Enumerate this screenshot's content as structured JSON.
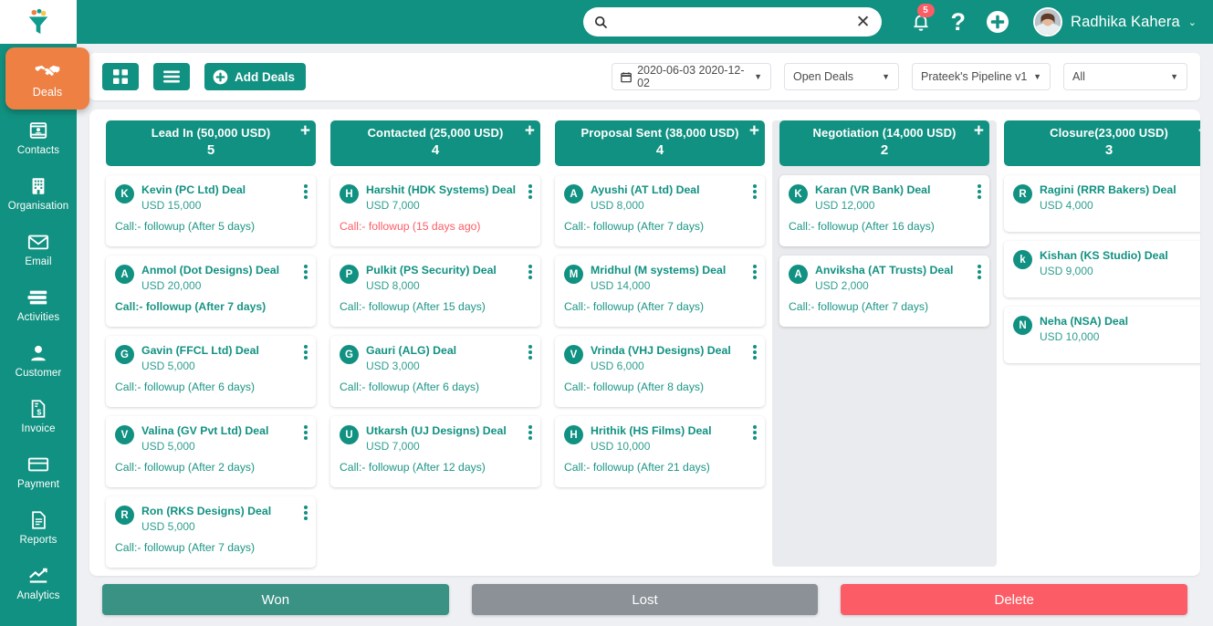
{
  "brand": {
    "primary": "#119181",
    "accent": "#ee8043",
    "danger": "#fc5c65",
    "muted": "#8b9196"
  },
  "sidebar": {
    "logo_icon": "funnel-logo-icon",
    "items": [
      {
        "label": "Deals",
        "icon": "handshake-icon",
        "active": true
      },
      {
        "label": "Contacts",
        "icon": "contact-card-icon",
        "active": false
      },
      {
        "label": "Organisation",
        "icon": "building-icon",
        "active": false
      },
      {
        "label": "Email",
        "icon": "envelope-icon",
        "active": false
      },
      {
        "label": "Activities",
        "icon": "list-stack-icon",
        "active": false
      },
      {
        "label": "Customer",
        "icon": "person-icon",
        "active": false
      },
      {
        "label": "Invoice",
        "icon": "invoice-dollar-icon",
        "active": false
      },
      {
        "label": "Payment",
        "icon": "credit-card-icon",
        "active": false
      },
      {
        "label": "Reports",
        "icon": "document-lines-icon",
        "active": false
      },
      {
        "label": "Analytics",
        "icon": "trend-up-icon",
        "active": false
      }
    ]
  },
  "topbar": {
    "search": {
      "value": "",
      "placeholder": "",
      "icon": "search-icon",
      "clear_icon": "close-icon",
      "clear_glyph": "✕"
    },
    "notification": {
      "icon": "bell-icon",
      "badge": "5"
    },
    "help": {
      "icon": "question-mark-icon",
      "glyph": "?"
    },
    "add": {
      "icon": "plus-circle-icon"
    },
    "user": {
      "name": "Radhika Kahera",
      "avatar_icon": "user-avatar",
      "caret_icon": "chevron-down-icon",
      "caret_glyph": "⌄"
    }
  },
  "toolbar": {
    "grid_view": {
      "icon": "grid-view-icon",
      "label": ""
    },
    "list_view": {
      "icon": "list-view-icon",
      "label": ""
    },
    "add_deals": {
      "label": "Add Deals",
      "icon": "plus-circle-icon"
    },
    "filters": [
      {
        "name": "date-range",
        "value": "2020-06-03 2020-12-02",
        "icon": "calendar-icon",
        "caret": "▼"
      },
      {
        "name": "deal-status",
        "value": "Open Deals",
        "caret": "▼"
      },
      {
        "name": "pipeline",
        "value": "Prateek's Pipeline v1",
        "caret": "▼"
      },
      {
        "name": "owner",
        "value": "All",
        "caret": "▼"
      }
    ]
  },
  "board": {
    "columns": [
      {
        "title": "Lead In (50,000 USD)",
        "count": "5",
        "highlighted": false,
        "add_icon": "plus-icon",
        "cards": [
          {
            "initial": "K",
            "title": "Kevin (PC Ltd) Deal",
            "amount": "USD 15,000",
            "followup": "Call:- followup (After 5 days)",
            "overdue": false,
            "bold": false
          },
          {
            "initial": "A",
            "title": "Anmol (Dot Designs) Deal",
            "amount": "USD 20,000",
            "followup": "Call:- followup (After 7 days)",
            "overdue": false,
            "bold": true
          },
          {
            "initial": "G",
            "title": "Gavin (FFCL Ltd) Deal",
            "amount": "USD 5,000",
            "followup": "Call:- followup (After 6 days)",
            "overdue": false,
            "bold": false
          },
          {
            "initial": "V",
            "title": "Valina (GV Pvt Ltd) Deal",
            "amount": "USD 5,000",
            "followup": "Call:- followup (After 2 days)",
            "overdue": false,
            "bold": false
          },
          {
            "initial": "R",
            "title": "Ron (RKS Designs) Deal",
            "amount": "USD 5,000",
            "followup": "Call:- followup (After 7 days)",
            "overdue": false,
            "bold": false
          }
        ]
      },
      {
        "title": "Contacted (25,000 USD)",
        "count": "4",
        "highlighted": false,
        "add_icon": "plus-icon",
        "cards": [
          {
            "initial": "H",
            "title": "Harshit (HDK Systems) Deal",
            "amount": "USD 7,000",
            "followup": "Call:- followup (15 days ago)",
            "overdue": true,
            "bold": false
          },
          {
            "initial": "P",
            "title": "Pulkit (PS Security) Deal",
            "amount": "USD 8,000",
            "followup": "Call:- followup (After 15 days)",
            "overdue": false,
            "bold": false
          },
          {
            "initial": "G",
            "title": "Gauri (ALG) Deal",
            "amount": "USD 3,000",
            "followup": "Call:- followup (After 6 days)",
            "overdue": false,
            "bold": false
          },
          {
            "initial": "U",
            "title": "Utkarsh (UJ Designs) Deal",
            "amount": "USD 7,000",
            "followup": "Call:- followup (After 12 days)",
            "overdue": false,
            "bold": false
          }
        ]
      },
      {
        "title": "Proposal Sent (38,000 USD)",
        "count": "4",
        "highlighted": false,
        "add_icon": "plus-icon",
        "cards": [
          {
            "initial": "A",
            "title": "Ayushi (AT Ltd) Deal",
            "amount": "USD 8,000",
            "followup": "Call:- followup (After 7 days)",
            "overdue": false,
            "bold": false
          },
          {
            "initial": "M",
            "title": "Mridhul (M systems) Deal",
            "amount": "USD 14,000",
            "followup": "Call:- followup (After 7 days)",
            "overdue": false,
            "bold": false
          },
          {
            "initial": "V",
            "title": "Vrinda (VHJ Designs) Deal",
            "amount": "USD 6,000",
            "followup": "Call:- followup (After 8 days)",
            "overdue": false,
            "bold": false
          },
          {
            "initial": "H",
            "title": "Hrithik (HS Films) Deal",
            "amount": "USD 10,000",
            "followup": "Call:- followup (After 21 days)",
            "overdue": false,
            "bold": false
          }
        ]
      },
      {
        "title": "Negotiation (14,000 USD)",
        "count": "2",
        "highlighted": true,
        "add_icon": "plus-icon",
        "cards": [
          {
            "initial": "K",
            "title": "Karan (VR Bank) Deal",
            "amount": "USD 12,000",
            "followup": "Call:- followup (After 16 days)",
            "overdue": false,
            "bold": false
          },
          {
            "initial": "A",
            "title": "Anviksha (AT Trusts) Deal",
            "amount": "USD 2,000",
            "followup": "Call:- followup (After 7 days)",
            "overdue": false,
            "bold": false
          }
        ]
      },
      {
        "title": "Closure(23,000 USD)",
        "count": "3",
        "highlighted": false,
        "add_icon": "plus-icon",
        "cards": [
          {
            "initial": "R",
            "title": "Ragini (RRR Bakers) Deal",
            "amount": "USD 4,000",
            "followup": "",
            "overdue": false,
            "bold": false
          },
          {
            "initial": "k",
            "title": "Kishan (KS Studio) Deal",
            "amount": "USD 9,000",
            "followup": "",
            "overdue": false,
            "bold": false
          },
          {
            "initial": "N",
            "title": "Neha (NSA) Deal",
            "amount": "USD 10,000",
            "followup": "",
            "overdue": false,
            "bold": false
          }
        ]
      }
    ]
  },
  "footer": {
    "won": "Won",
    "lost": "Lost",
    "delete": "Delete"
  }
}
